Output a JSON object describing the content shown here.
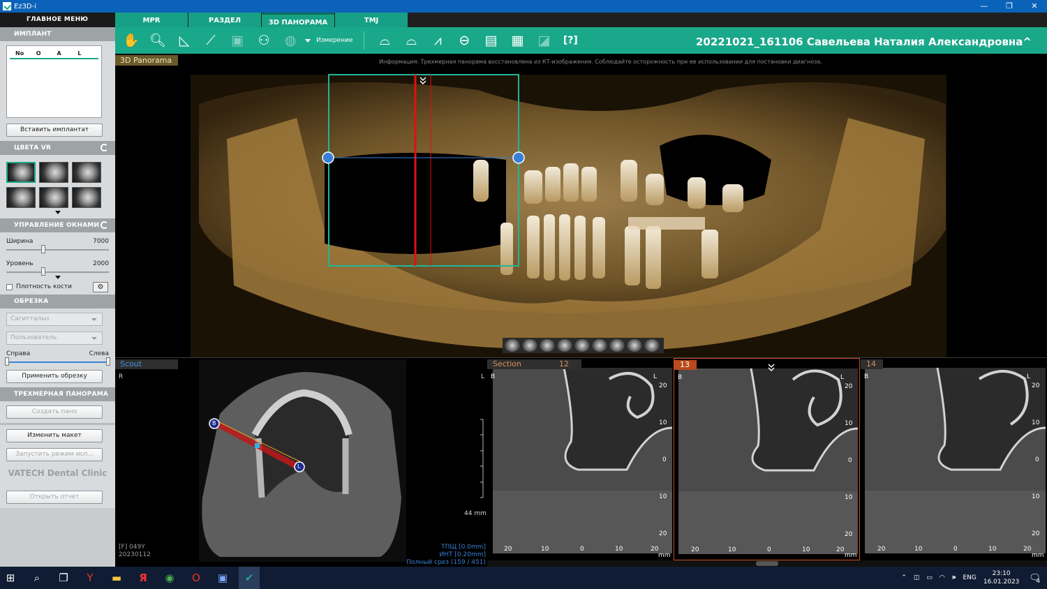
{
  "titlebar": {
    "title": "Ez3D-i",
    "minimize": "—",
    "restore": "❐",
    "close": "✕"
  },
  "sidebar": {
    "main_menu": "ГЛАВНОЕ МЕНЮ",
    "implant": {
      "header": "ИМПЛАНТ",
      "columns": [
        "No",
        "O",
        "A",
        "L"
      ],
      "insert_button": "Вставить имплантат"
    },
    "vr_colors": {
      "header": "ЦВЕТА VR"
    },
    "window_control": {
      "header": "УПРАВЛЕНИЕ ОКНАМИ",
      "width_label": "Ширина",
      "width_value": "7000",
      "level_label": "Уровень",
      "level_value": "2000",
      "bone_density_label": "Плотность кости"
    },
    "crop": {
      "header": "ОБРЕЗКА",
      "select_1": "Сагиттальн",
      "select_2": "Пользователь",
      "right_label": "Справа",
      "left_label": "Слева",
      "apply_button": "Применить обрезку"
    },
    "pano3d": {
      "header": "ТРЕХМЕРНАЯ ПАНОРАМА",
      "create_button": "Создать пано"
    },
    "change_layout_button": "Изменить макет",
    "run_mode_button": "Запустить режим исп...",
    "clinic_name": "VATECH Dental Clinic",
    "open_report_button": "Открыть отчет"
  },
  "tabs": [
    {
      "label": "MPR"
    },
    {
      "label": "РАЗДЕЛ"
    },
    {
      "label": "3D ПАНОРАМА"
    },
    {
      "label": "TMJ"
    }
  ],
  "toolbar": {
    "measure_label": "Измерение",
    "patient": "20221021_161106 Савельева Наталия Александровна^"
  },
  "pano": {
    "label": "3D Panorama",
    "info": "Информация: Трехмерная панорама восстановлена из КТ-изображения. Соблюдайте осторожность при ее использовании для постановки диагноза."
  },
  "scout": {
    "label": "Scout",
    "right_marker": "R",
    "left_marker": "L",
    "handle_b": "B",
    "handle_l": "L",
    "scale_text": "44 mm",
    "patient_info_1": "[F] 049Y",
    "patient_info_2": "20230112",
    "thickness": "ТПЩ [0.0mm]",
    "interval": "ИНТ [0.20mm]",
    "full_slice": "Полный срез (159 / 451)"
  },
  "sections": {
    "label": "Section",
    "panels": [
      {
        "index": "12",
        "left": "B",
        "right": "L"
      },
      {
        "index": "13",
        "left": "B",
        "right": "L"
      },
      {
        "index": "14",
        "left": "B",
        "right": "L"
      }
    ],
    "y_ticks": [
      "20",
      "10",
      "0",
      "10",
      "20"
    ],
    "x_ticks": [
      "20",
      "10",
      "0",
      "10",
      "20"
    ],
    "unit": "mm"
  },
  "taskbar": {
    "lang": "ENG",
    "time": "23:10",
    "date": "16.01.2023",
    "notifications": "4"
  }
}
